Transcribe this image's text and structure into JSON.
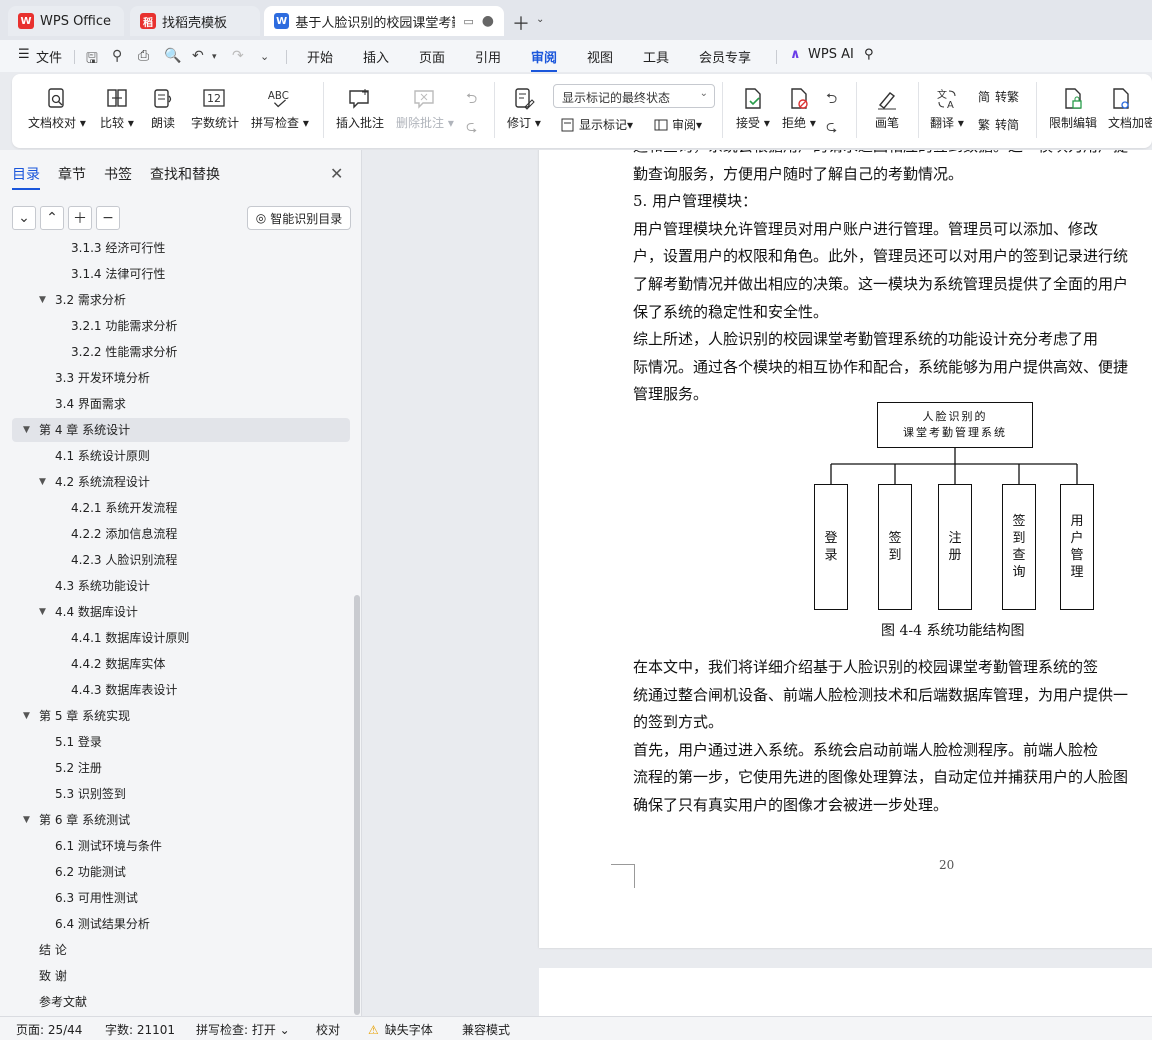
{
  "tabs": [
    {
      "label": "WPS Office",
      "logo": "W",
      "logo_color": "#e8312f"
    },
    {
      "label": "找稻壳模板",
      "logo": "稻",
      "logo_color": "#e8312f"
    },
    {
      "label": "基于人脸识别的校园课堂考勤",
      "logo": "W",
      "logo_color": "#2d6cdf",
      "active": true
    }
  ],
  "menu": {
    "file": "文件",
    "items": [
      "开始",
      "插入",
      "页面",
      "引用",
      "审阅",
      "视图",
      "工具",
      "会员专享"
    ],
    "active": "审阅",
    "wps_ai": "WPS AI"
  },
  "ribbon": {
    "doc_check": "文档校对",
    "compare": "比较",
    "read_aloud": "朗读",
    "word_count": "字数统计",
    "spell_check": "拼写检查",
    "insert_comment": "插入批注",
    "delete_comment": "删除批注",
    "revise": "修订",
    "markup_state": "显示标记的最终状态",
    "show_markup": "显示标记",
    "review": "审阅",
    "accept": "接受",
    "reject": "拒绝",
    "pen": "画笔",
    "translate": "翻译",
    "to_traditional": "转繁",
    "to_simplified": "转简",
    "restrict_edit": "限制编辑",
    "doc_encrypt": "文档加密"
  },
  "nav": {
    "tabs": [
      "目录",
      "章节",
      "书签",
      "查找和替换"
    ],
    "active_tab": "目录",
    "smart_toc": "智能识别目录",
    "toc": [
      {
        "text": "3.1.3  经济可行性",
        "level": 3
      },
      {
        "text": "3.1.4  法律可行性",
        "level": 3
      },
      {
        "text": "3.2 需求分析",
        "level": 2,
        "expanded": true
      },
      {
        "text": "3.2.1  功能需求分析",
        "level": 3
      },
      {
        "text": "3.2.2  性能需求分析",
        "level": 3
      },
      {
        "text": "3.3 开发环境分析",
        "level": 2
      },
      {
        "text": "3.4 界面需求",
        "level": 2
      },
      {
        "text": "第 4 章  系统设计",
        "level": 1,
        "expanded": true,
        "selected": true
      },
      {
        "text": "4.1 系统设计原则",
        "level": 2
      },
      {
        "text": "4.2 系统流程设计",
        "level": 2,
        "expanded": true
      },
      {
        "text": "4.2.1 系统开发流程",
        "level": 3
      },
      {
        "text": "4.2.2  添加信息流程",
        "level": 3
      },
      {
        "text": "4.2.3  人脸识别流程",
        "level": 3
      },
      {
        "text": "4.3  系统功能设计",
        "level": 2
      },
      {
        "text": "4.4  数据库设计",
        "level": 2,
        "expanded": true
      },
      {
        "text": "4.4.1  数据库设计原则",
        "level": 3
      },
      {
        "text": "4.4.2  数据库实体",
        "level": 3
      },
      {
        "text": "4.4.3  数据库表设计",
        "level": 3
      },
      {
        "text": "第 5 章  系统实现",
        "level": 1,
        "expanded": true
      },
      {
        "text": "5.1  登录",
        "level": 2
      },
      {
        "text": "5.2  注册",
        "level": 2
      },
      {
        "text": "5.3  识别签到",
        "level": 2
      },
      {
        "text": "第 6 章  系统测试",
        "level": 1,
        "expanded": true
      },
      {
        "text": "6.1 测试环境与条件",
        "level": 2
      },
      {
        "text": "6.2 功能测试",
        "level": 2
      },
      {
        "text": "6.3 可用性测试",
        "level": 2
      },
      {
        "text": "6.4 测试结果分析",
        "level": 2
      },
      {
        "text": "结      论",
        "level": 1
      },
      {
        "text": "致      谢",
        "level": 1
      },
      {
        "text": "参考文献",
        "level": 1
      }
    ]
  },
  "document": {
    "lines_top": [
      "远和查询，系统会根据用户的请求返回相应的签到数据。这一模块为用户提",
      "勤查询服务，方便用户随时了解自己的考勤情况。",
      "    5. 用户管理模块：",
      "    用户管理模块允许管理员对用户账户进行管理。管理员可以添加、修改",
      "户，设置用户的权限和角色。此外，管理员还可以对用户的签到记录进行统",
      "了解考勤情况并做出相应的决策。这一模块为系统管理员提供了全面的用户",
      "保了系统的稳定性和安全性。",
      "    综上所述，人脸识别的校园课堂考勤管理系统的功能设计充分考虑了用",
      "际情况。通过各个模块的相互协作和配合，系统能够为用户提供高效、便捷",
      "管理服务。"
    ],
    "diagram": {
      "root_line1": "人脸识别的",
      "root_line2": "课堂考勤管理系统",
      "leaves": [
        "登录",
        "签到",
        "注册",
        "签到查询",
        "用户管理"
      ]
    },
    "caption": "图 4-4  系统功能结构图",
    "lines_bottom": [
      "    在本文中，我们将详细介绍基于人脸识别的校园课堂考勤管理系统的签",
      "统通过整合闸机设备、前端人脸检测技术和后端数据库管理，为用户提供一",
      "的签到方式。",
      "    首先，用户通过进入系统。系统会启动前端人脸检测程序。前端人脸检",
      "流程的第一步，它使用先进的图像处理算法，自动定位并捕获用户的人脸图",
      "确保了只有真实用户的图像才会被进一步处理。"
    ],
    "page_number": "20"
  },
  "status": {
    "page": "页面: 25/44",
    "words": "字数: 21101",
    "spell": "拼写检查: 打开",
    "proof": "校对",
    "missing_font": "缺失字体",
    "compat": "兼容模式"
  }
}
